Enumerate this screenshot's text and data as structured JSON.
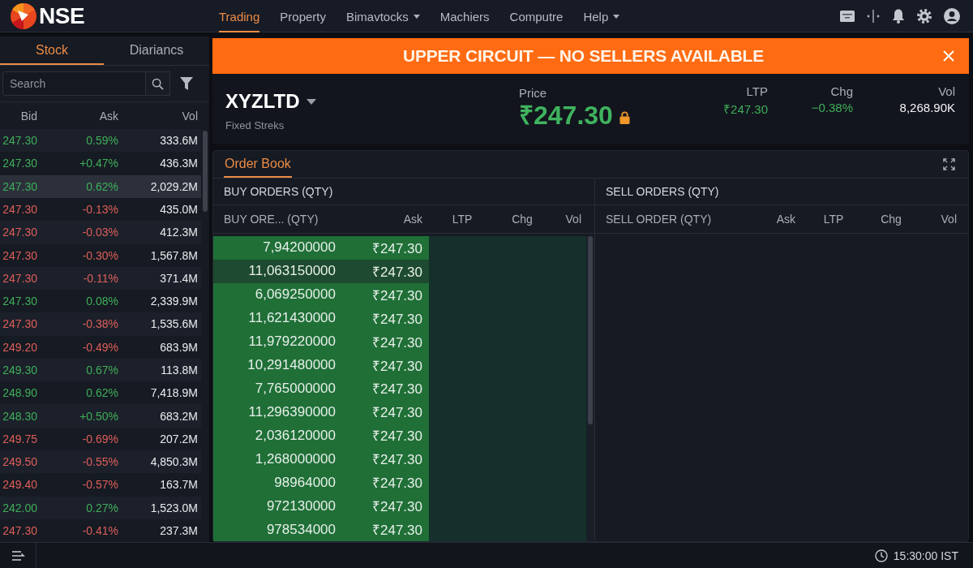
{
  "header": {
    "logo": "NSE",
    "nav": [
      {
        "label": "Trading",
        "selected": true,
        "dropdown": false
      },
      {
        "label": "Property",
        "selected": false,
        "dropdown": false
      },
      {
        "label": "Bimavtocks",
        "selected": false,
        "dropdown": true
      },
      {
        "label": "Machiers",
        "selected": false,
        "dropdown": false
      },
      {
        "label": "Computre",
        "selected": false,
        "dropdown": false
      },
      {
        "label": "Help",
        "selected": false,
        "dropdown": true
      }
    ]
  },
  "sidebar": {
    "tabs": [
      {
        "label": "Stock",
        "selected": true
      },
      {
        "label": "Diariancs",
        "selected": false
      }
    ],
    "search": {
      "placeholder": "Search"
    },
    "columns": [
      "Bid",
      "Ask",
      "Vol"
    ],
    "rows": [
      {
        "bid": "247.30",
        "ask": "0.59%",
        "vol": "333.6M",
        "color": "#3fae5a",
        "selected": false
      },
      {
        "bid": "247.30",
        "ask": "+0.47%",
        "vol": "436.3M",
        "color": "#3fae5a",
        "selected": false
      },
      {
        "bid": "247.30",
        "ask": "0.62%",
        "vol": "2,029.2M",
        "color": "#3fae5a",
        "selected": true
      },
      {
        "bid": "247.30",
        "ask": "-0.13%",
        "vol": "435.0M",
        "color": "#de5f5a",
        "selected": false
      },
      {
        "bid": "247.30",
        "ask": "-0.03%",
        "vol": "412.3M",
        "color": "#de5f5a",
        "selected": false
      },
      {
        "bid": "247.30",
        "ask": "-0.30%",
        "vol": "1,567.8M",
        "color": "#de5f5a",
        "selected": false
      },
      {
        "bid": "247.30",
        "ask": "-0.11%",
        "vol": "371.4M",
        "color": "#de5f5a",
        "selected": false
      },
      {
        "bid": "247.30",
        "ask": "0.08%",
        "vol": "2,339.9M",
        "color": "#3fae5a",
        "selected": false
      },
      {
        "bid": "247.30",
        "ask": "-0.38%",
        "vol": "1,535.6M",
        "color": "#de5f5a",
        "selected": false
      },
      {
        "bid": "249.20",
        "ask": "-0.49%",
        "vol": "683.9M",
        "color": "#de5f5a",
        "selected": false
      },
      {
        "bid": "249.30",
        "ask": "0.67%",
        "vol": "113.8M",
        "color": "#3fae5a",
        "selected": false
      },
      {
        "bid": "248.90",
        "ask": "0.62%",
        "vol": "7,418.9M",
        "color": "#3fae5a",
        "selected": false
      },
      {
        "bid": "248.30",
        "ask": "+0.50%",
        "vol": "683.2M",
        "color": "#3fae5a",
        "selected": false
      },
      {
        "bid": "249.75",
        "ask": "-0.69%",
        "vol": "207.2M",
        "color": "#de5f5a",
        "selected": false
      },
      {
        "bid": "249.50",
        "ask": "-0.55%",
        "vol": "4,850.3M",
        "color": "#de5f5a",
        "selected": false
      },
      {
        "bid": "249.40",
        "ask": "-0.57%",
        "vol": "163.7M",
        "color": "#de5f5a",
        "selected": false
      },
      {
        "bid": "242.00",
        "ask": "0.27%",
        "vol": "1,523.0M",
        "color": "#3fae5a",
        "selected": false
      },
      {
        "bid": "247.30",
        "ask": "-0.41%",
        "vol": "237.3M",
        "color": "#de5f5a",
        "selected": false
      }
    ]
  },
  "alert": {
    "message": "UPPER CIRCUIT — NO SELLERS AVAILABLE"
  },
  "quote": {
    "symbol": "XYZLTD",
    "subtitle": "Fixed Streks",
    "price_label": "Price",
    "price": "₹247.30",
    "locked": true,
    "stats": [
      {
        "label": "LTP",
        "value": "₹247.30",
        "color": "#3fae5a"
      },
      {
        "label": "Chg",
        "value": "−0.38%",
        "color": "#3fae5a"
      },
      {
        "label": "Vol",
        "value": "8,268.90K",
        "color": "#f2f3f5"
      }
    ]
  },
  "order_book": {
    "tabs": [
      {
        "label": "Order Book",
        "selected": true
      }
    ],
    "buy": {
      "title": "BUY ORDERS (QTY)",
      "columns": [
        "BUY ORE... (QTY)",
        "Ask",
        "LTP",
        "Chg",
        "Vol"
      ],
      "rows": [
        {
          "qty": "7,94200000",
          "ask": "₹247.30",
          "selected": false
        },
        {
          "qty": "11,063150000",
          "ask": "₹247.30",
          "selected": true
        },
        {
          "qty": "6,069250000",
          "ask": "₹247.30",
          "selected": false
        },
        {
          "qty": "11,621430000",
          "ask": "₹247.30",
          "selected": false
        },
        {
          "qty": "11,979220000",
          "ask": "₹247.30",
          "selected": false
        },
        {
          "qty": "10,291480000",
          "ask": "₹247.30",
          "selected": false
        },
        {
          "qty": "7,765000000",
          "ask": "₹247.30",
          "selected": false
        },
        {
          "qty": "11,296390000",
          "ask": "₹247.30",
          "selected": false
        },
        {
          "qty": "2,036120000",
          "ask": "₹247.30",
          "selected": false
        },
        {
          "qty": "1,268000000",
          "ask": "₹247.30",
          "selected": false
        },
        {
          "qty": "98964000",
          "ask": "₹247.30",
          "selected": false
        },
        {
          "qty": "972130000",
          "ask": "₹247.30",
          "selected": false
        },
        {
          "qty": "978534000",
          "ask": "₹247.30",
          "selected": false
        }
      ]
    },
    "sell": {
      "title": "SELL ORDERS (QTY)",
      "columns": [
        "SELL ORDER (QTY)",
        "Ask",
        "LTP",
        "Chg",
        "Vol"
      ]
    }
  },
  "status_bar": {
    "time": "15:30:00 IST"
  }
}
